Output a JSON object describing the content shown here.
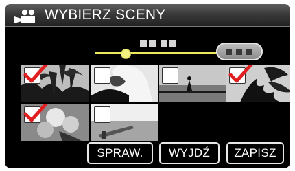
{
  "header": {
    "title": "WYBIERZ SCENY",
    "icon": "movie-camera-icon"
  },
  "scroll": {
    "page_indicator_icon": "page-dots-icon",
    "pill_icon": "more-pages-icon"
  },
  "thumbnails": [
    {
      "scene": "palm-trees",
      "checked": true
    },
    {
      "scene": "reading-person",
      "checked": false
    },
    {
      "scene": "silhouette-shore",
      "checked": false
    },
    {
      "scene": "leaves-silhouette",
      "checked": true
    },
    {
      "scene": "flowers-closeup",
      "checked": true
    },
    {
      "scene": "pier-sea",
      "checked": false
    }
  ],
  "buttons": {
    "check": "SPRAW.",
    "exit": "WYJDŹ",
    "save": "ZAPISZ"
  },
  "colors": {
    "accent_check": "#e02020",
    "slider": "#ede85a",
    "background": "#000000"
  }
}
